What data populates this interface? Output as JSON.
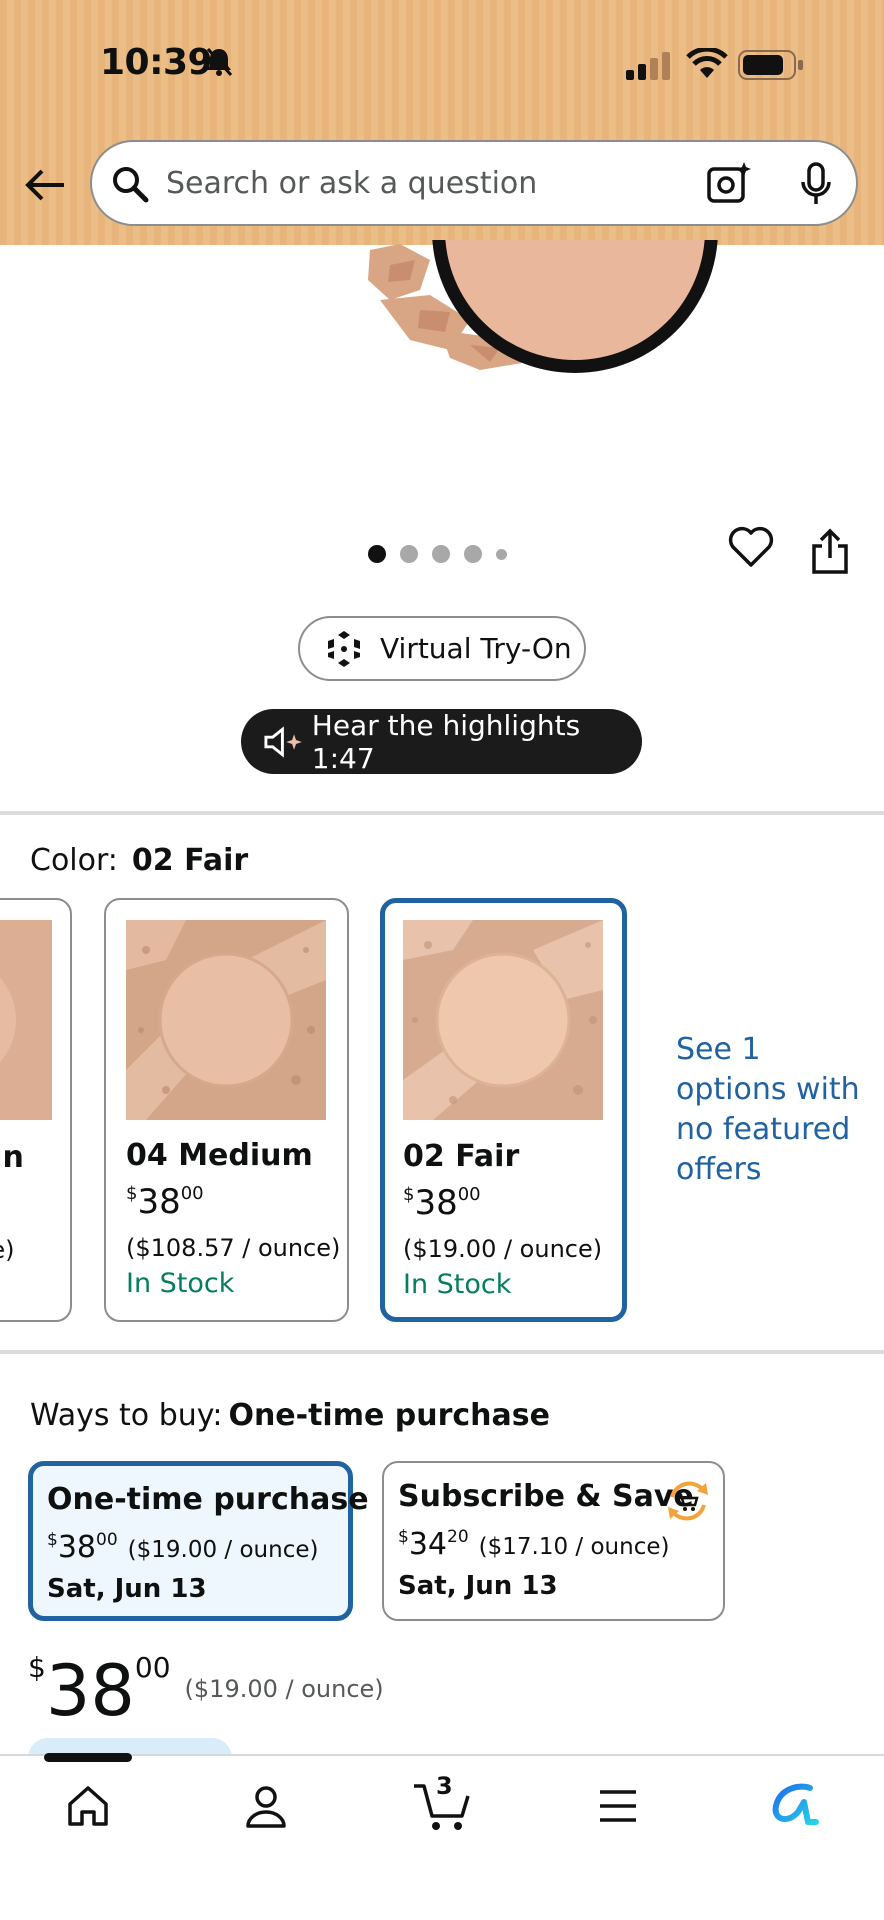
{
  "status_bar": {
    "time": "10:39"
  },
  "search": {
    "placeholder": "Search or ask a question"
  },
  "gallery": {
    "image_count": 5,
    "active_index": 0
  },
  "buttons": {
    "virtual_try_on": "Virtual Try-On",
    "hear_highlights": "Hear the highlights 1:47"
  },
  "color": {
    "label": "Color:",
    "selected": "02 Fair",
    "swatches": [
      {
        "name": "ain",
        "unit": "nce)"
      },
      {
        "name": "04 Medium",
        "price_whole": "38",
        "price_frac": "00",
        "unit": "($108.57 / ounce)",
        "stock": "In Stock"
      },
      {
        "name": "02 Fair",
        "price_whole": "38",
        "price_frac": "00",
        "unit": "($19.00 / ounce)",
        "stock": "In Stock"
      }
    ],
    "see_options": "See 1 options with no featured offers"
  },
  "ways_to_buy": {
    "label": "Ways to buy:",
    "selected": "One-time purchase",
    "options": [
      {
        "title": "One-time purchase",
        "price_whole": "38",
        "price_frac": "00",
        "unit": "($19.00 / ounce)",
        "delivery": "Sat, Jun 13"
      },
      {
        "title": "Subscribe & Save",
        "price_whole": "34",
        "price_frac": "20",
        "unit": "($17.10 / ounce)",
        "delivery": "Sat, Jun 13"
      }
    ]
  },
  "price": {
    "currency": "$",
    "whole": "38",
    "fraction": "00",
    "unit": "($19.00 / ounce)"
  },
  "bottom_nav": {
    "items": [
      "home-icon",
      "account-icon",
      "cart-icon",
      "menu-icon",
      "rufus-icon"
    ],
    "cart_count": "3"
  },
  "colors": {
    "header": "#e7b57c",
    "link": "#2162a1",
    "stock": "#067d62",
    "selected_border": "#2162a1"
  }
}
